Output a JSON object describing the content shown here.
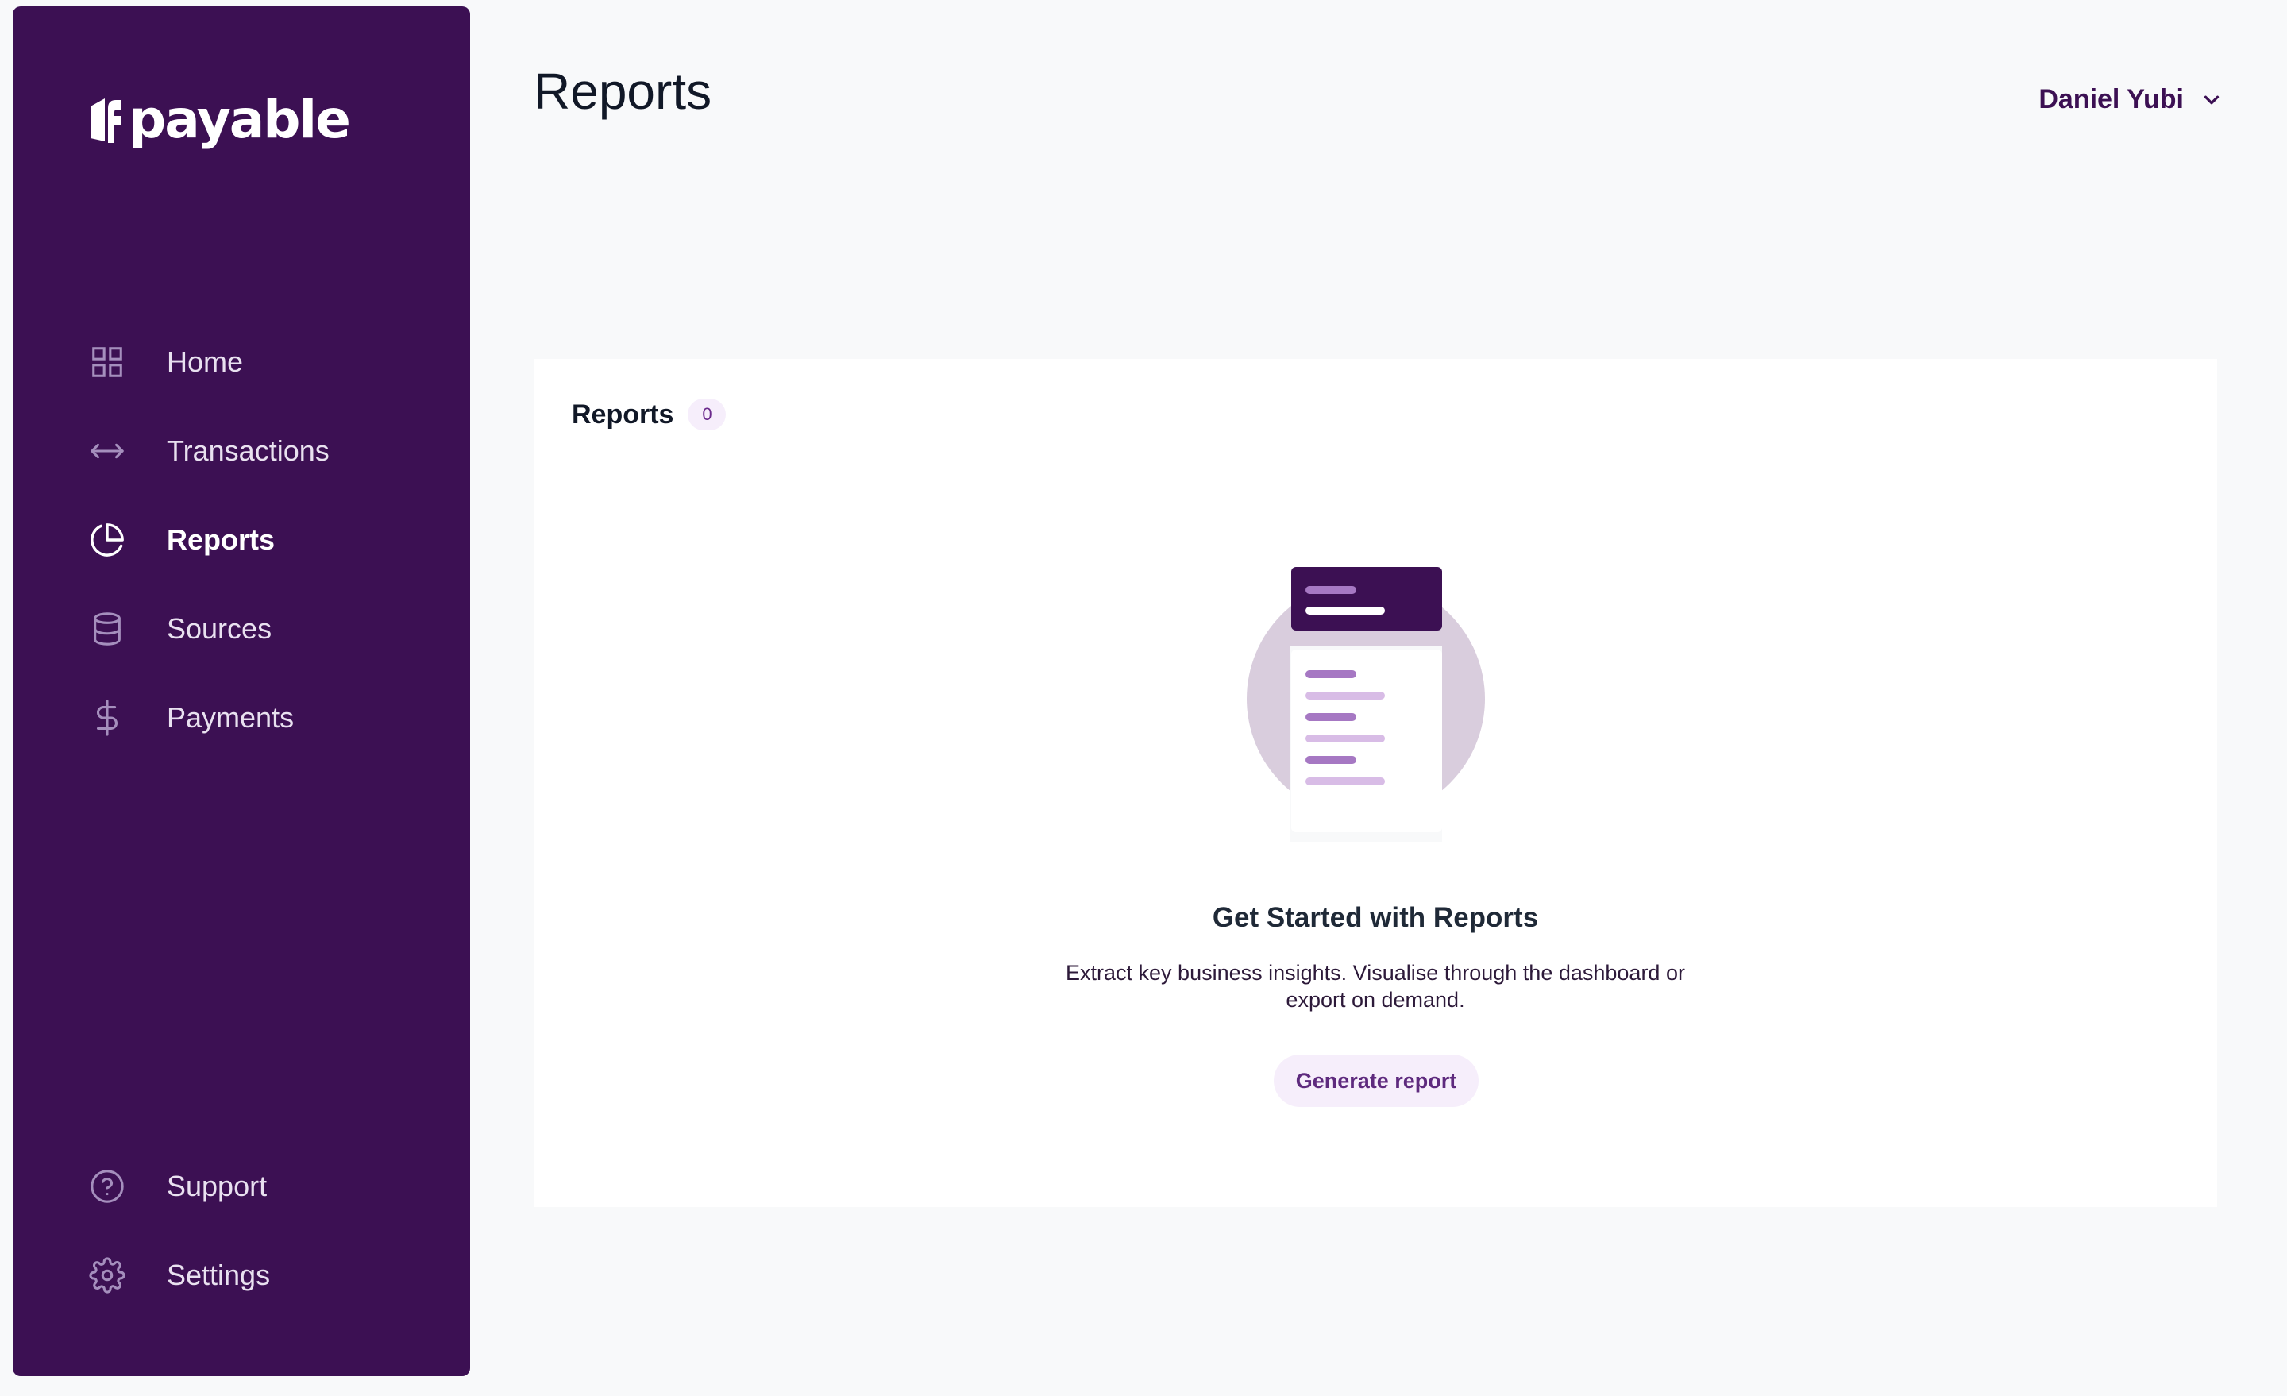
{
  "brand": {
    "name": "payable"
  },
  "page": {
    "title": "Reports"
  },
  "user": {
    "name": "Daniel Yubi"
  },
  "sidebar": {
    "items": [
      {
        "label": "Home",
        "icon": "grid-icon"
      },
      {
        "label": "Transactions",
        "icon": "arrows-horizontal-icon"
      },
      {
        "label": "Reports",
        "icon": "pie-chart-icon",
        "active": true
      },
      {
        "label": "Sources",
        "icon": "database-icon"
      },
      {
        "label": "Payments",
        "icon": "dollar-icon"
      }
    ],
    "bottom_items": [
      {
        "label": "Support",
        "icon": "help-circle-icon"
      },
      {
        "label": "Settings",
        "icon": "gear-icon"
      }
    ]
  },
  "reports_card": {
    "title": "Reports",
    "count": "0",
    "empty_state": {
      "title": "Get Started with Reports",
      "description": "Extract key business insights. Visualise through the dashboard or export on demand.",
      "button_label": "Generate report"
    }
  },
  "colors": {
    "sidebar_bg": "#3c1053",
    "accent": "#5e2a7e",
    "background": "#f8f9fa"
  }
}
